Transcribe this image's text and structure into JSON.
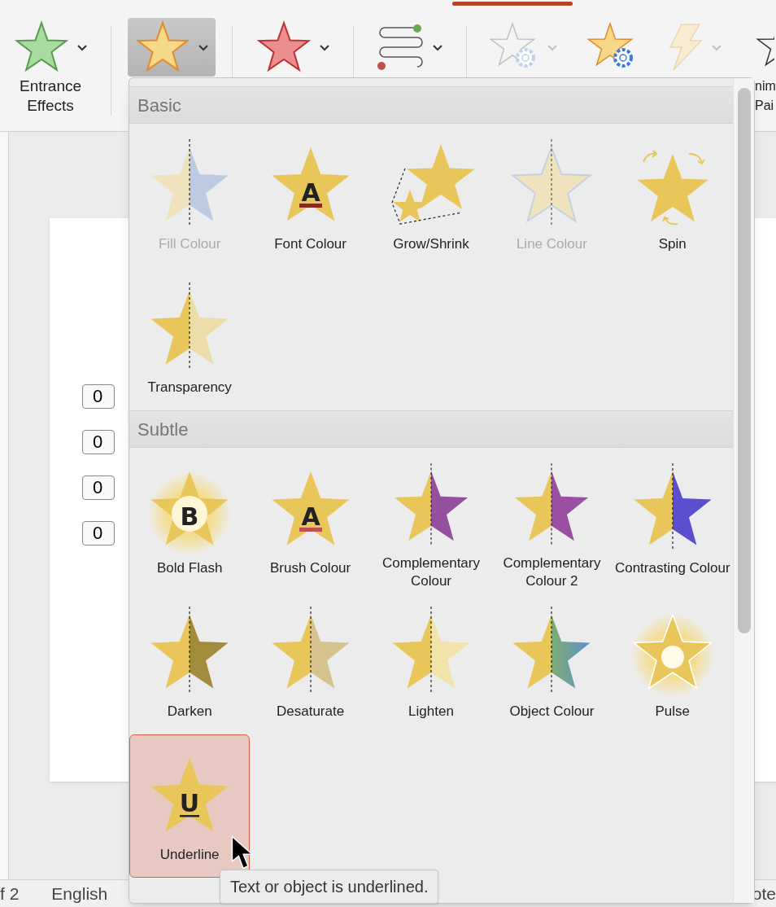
{
  "ribbon": {
    "buttons": [
      {
        "kind": "entrance",
        "labels": [
          "Entrance",
          "Effects"
        ],
        "selected": false,
        "disabled": false
      },
      {
        "kind": "emphasis",
        "selected": true,
        "disabled": false
      },
      {
        "kind": "exit",
        "selected": false,
        "disabled": false
      },
      {
        "kind": "motion",
        "selected": false,
        "disabled": false
      },
      {
        "kind": "effect-options",
        "selected": false,
        "disabled": true
      },
      {
        "kind": "add-animation",
        "selected": false,
        "disabled": false
      },
      {
        "kind": "trigger",
        "selected": false,
        "disabled": true
      },
      {
        "kind": "painter",
        "labels": [
          "nim",
          "Pai"
        ],
        "selected": false,
        "disabled": false
      }
    ]
  },
  "slide": {
    "tags": [
      "0",
      "0",
      "0",
      "0"
    ]
  },
  "gallery": {
    "sections": [
      {
        "title": "Basic",
        "items": [
          {
            "label": "Fill Colour",
            "disabled": true,
            "selected": false
          },
          {
            "label": "Font Colour",
            "disabled": false,
            "selected": false,
            "glyph": "A"
          },
          {
            "label": "Grow/Shrink",
            "disabled": false,
            "selected": false
          },
          {
            "label": "Line Colour",
            "disabled": true,
            "selected": false
          },
          {
            "label": "Spin",
            "disabled": false,
            "selected": false
          },
          {
            "label": "Transparency",
            "disabled": false,
            "selected": false
          }
        ]
      },
      {
        "title": "Subtle",
        "items": [
          {
            "label": "Bold Flash",
            "disabled": false,
            "selected": false,
            "glyph": "B"
          },
          {
            "label": "Brush Colour",
            "disabled": false,
            "selected": false,
            "glyph": "A"
          },
          {
            "label": "Complementary Colour",
            "disabled": false,
            "selected": false
          },
          {
            "label": "Complementary Colour 2",
            "disabled": false,
            "selected": false
          },
          {
            "label": "Contrasting Colour",
            "disabled": false,
            "selected": false
          },
          {
            "label": "Darken",
            "disabled": false,
            "selected": false
          },
          {
            "label": "Desaturate",
            "disabled": false,
            "selected": false
          },
          {
            "label": "Lighten",
            "disabled": false,
            "selected": false
          },
          {
            "label": "Object Colour",
            "disabled": false,
            "selected": false
          },
          {
            "label": "Pulse",
            "disabled": false,
            "selected": false
          },
          {
            "label": "Underline",
            "disabled": false,
            "selected": true,
            "glyph": "U"
          }
        ]
      }
    ],
    "tooltip": "Text or object is underlined."
  },
  "status_bar": [
    "f 2",
    "English",
    "ote"
  ]
}
